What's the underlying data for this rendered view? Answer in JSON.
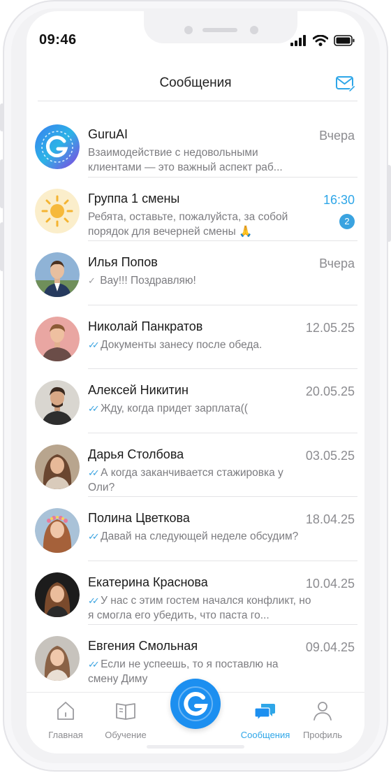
{
  "status_bar": {
    "time": "09:46"
  },
  "header": {
    "title": "Сообщения"
  },
  "chats": [
    {
      "name": "GuruAI",
      "date": "Вчера",
      "preview": "Взаимодействие с недовольными клиентами — это важный аспект раб...",
      "check": "",
      "badge": "",
      "avatar": "guru-logo-avatar"
    },
    {
      "name": "Группа 1 смены",
      "date": "16:30",
      "preview": "Ребята, оставьте, пожалуйста, за собой порядок для вечерней смены 🙏",
      "check": "",
      "badge": "2",
      "avatar": "sun-avatar"
    },
    {
      "name": "Илья Попов",
      "date": "Вчера",
      "preview": "Вау!!! Поздравляю!",
      "check": "✓",
      "badge": "",
      "avatar": "user-photo"
    },
    {
      "name": "Николай Панкратов",
      "date": "12.05.25",
      "preview": "Документы занесу после обеда.",
      "check": "✓✓",
      "badge": "",
      "avatar": "user-photo"
    },
    {
      "name": "Алексей Никитин",
      "date": "20.05.25",
      "preview": "Жду, когда придет зарплата((",
      "check": "✓✓",
      "badge": "",
      "avatar": "user-photo"
    },
    {
      "name": "Дарья Столбова",
      "date": "03.05.25",
      "preview": "А когда заканчивается стажировка у Оли?",
      "check": "✓✓",
      "badge": "",
      "avatar": "user-photo"
    },
    {
      "name": "Полина Цветкова",
      "date": "18.04.25",
      "preview": "Давай на следующей неделе обсудим?",
      "check": "✓✓",
      "badge": "",
      "avatar": "user-photo"
    },
    {
      "name": "Екатерина Краснова",
      "date": "10.04.25",
      "preview": "У нас с этим гостем начался конфликт, но я смогла его убедить, что паста го...",
      "check": "✓✓",
      "badge": "",
      "avatar": "user-photo"
    },
    {
      "name": "Евгения Смольная",
      "date": "09.04.25",
      "preview": "Если не успеешь, то я поставлю на смену Диму",
      "check": "✓✓",
      "badge": "",
      "avatar": "user-photo"
    }
  ],
  "tabbar": {
    "home": "Главная",
    "learning": "Обучение",
    "messages": "Сообщения",
    "profile": "Профиль",
    "active": "messages"
  },
  "colors": {
    "accent": "#2ea6e8",
    "fab": "#1c8ff0",
    "badge": "#3aa3e0"
  }
}
